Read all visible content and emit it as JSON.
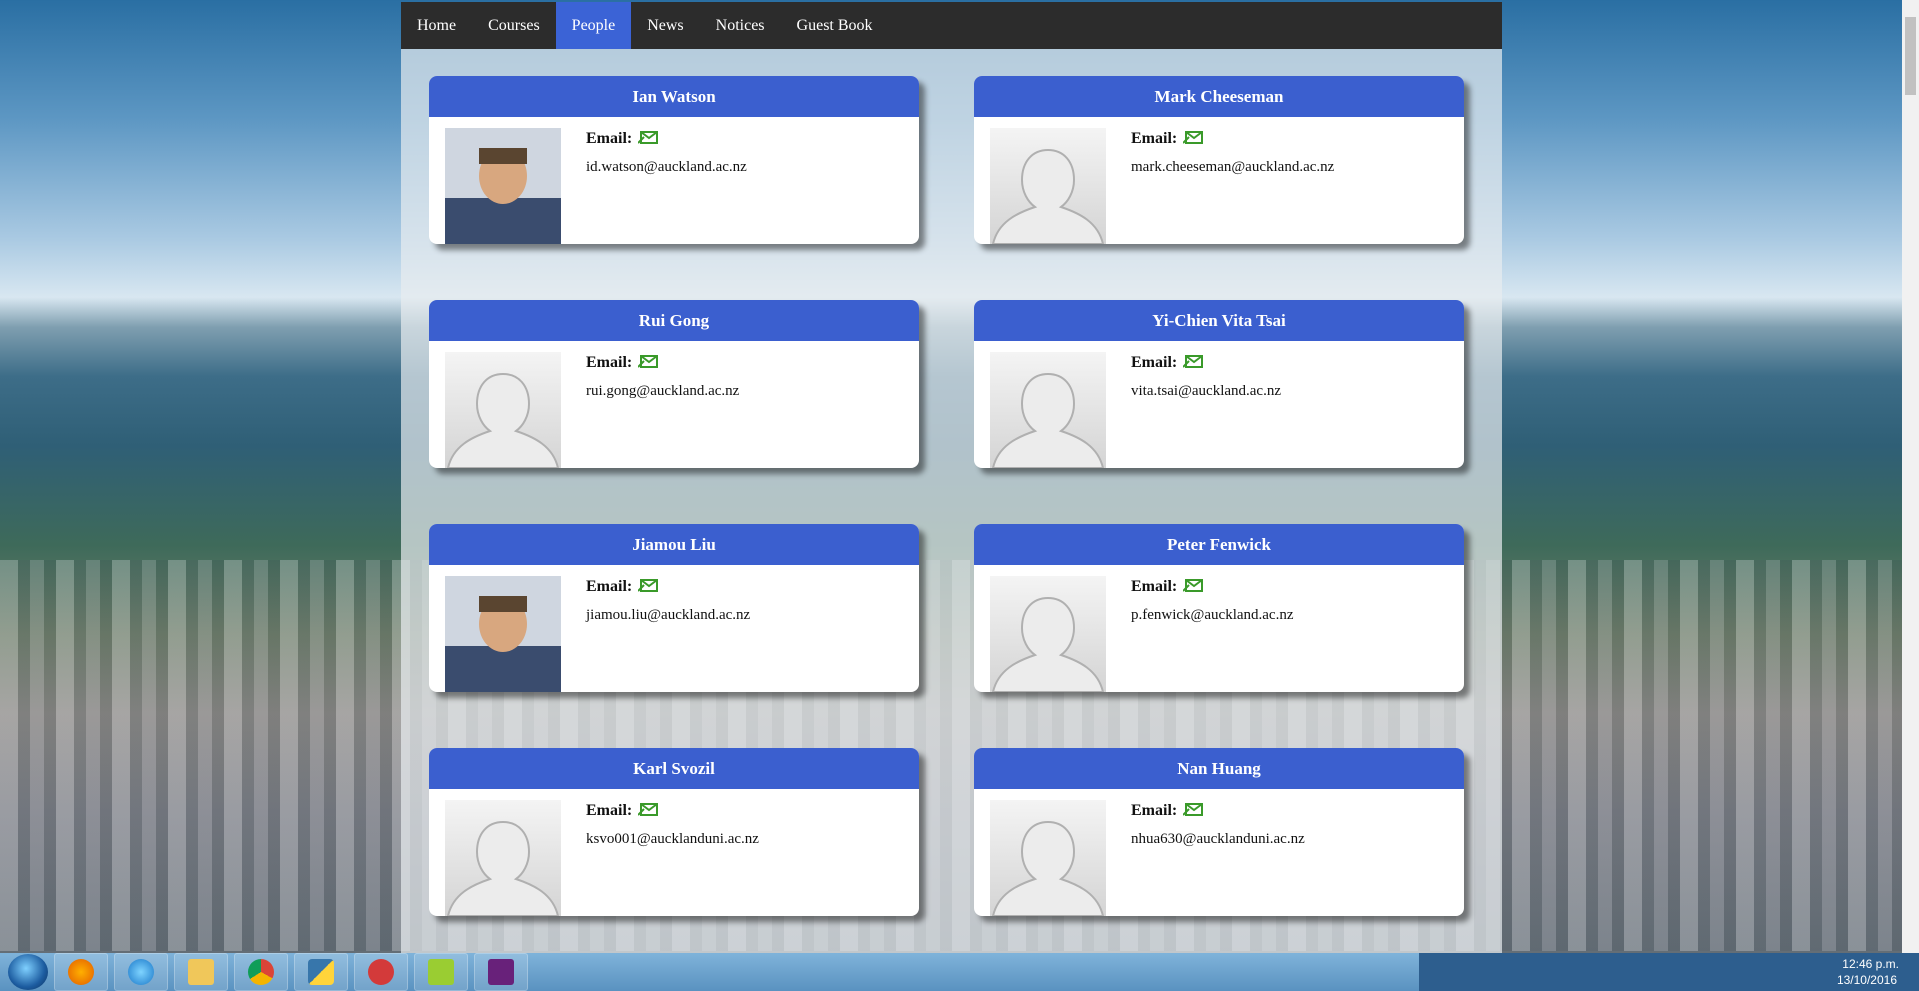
{
  "nav": {
    "items": [
      {
        "label": "Home"
      },
      {
        "label": "Courses"
      },
      {
        "label": "People"
      },
      {
        "label": "News"
      },
      {
        "label": "Notices"
      },
      {
        "label": "Guest Book"
      }
    ],
    "active_item": "People"
  },
  "email_label": "Email:",
  "people": [
    {
      "name": "Ian Watson",
      "email": "id.watson@auckland.ac.nz",
      "photo": "photo"
    },
    {
      "name": "Mark Cheeseman",
      "email": "mark.cheeseman@auckland.ac.nz",
      "photo": "placeholder"
    },
    {
      "name": "Rui Gong",
      "email": "rui.gong@auckland.ac.nz",
      "photo": "placeholder"
    },
    {
      "name": "Yi-Chien Vita Tsai",
      "email": "vita.tsai@auckland.ac.nz",
      "photo": "placeholder"
    },
    {
      "name": "Jiamou Liu",
      "email": "jiamou.liu@auckland.ac.nz",
      "photo": "photo"
    },
    {
      "name": "Peter Fenwick",
      "email": "p.fenwick@auckland.ac.nz",
      "photo": "placeholder"
    },
    {
      "name": "Karl Svozil",
      "email": "ksvo001@aucklanduni.ac.nz",
      "photo": "placeholder"
    },
    {
      "name": "Nan Huang",
      "email": "nhua630@aucklanduni.ac.nz",
      "photo": "placeholder"
    }
  ],
  "colors": {
    "navbar": "#2c2c2c",
    "nav_active": "#3b63d6",
    "card_header": "#3b5fcf",
    "mail_icon": "#3a9a2a"
  },
  "taskbar": {
    "apps": [
      "windows-start-icon",
      "firefox-icon",
      "internet-explorer-icon",
      "file-explorer-icon",
      "chrome-icon",
      "python-icon",
      "snipping-tool-icon",
      "notepad-plus-plus-icon",
      "visual-studio-icon"
    ],
    "clock_time": "12:46 p.m.",
    "clock_date": "13/10/2016"
  }
}
